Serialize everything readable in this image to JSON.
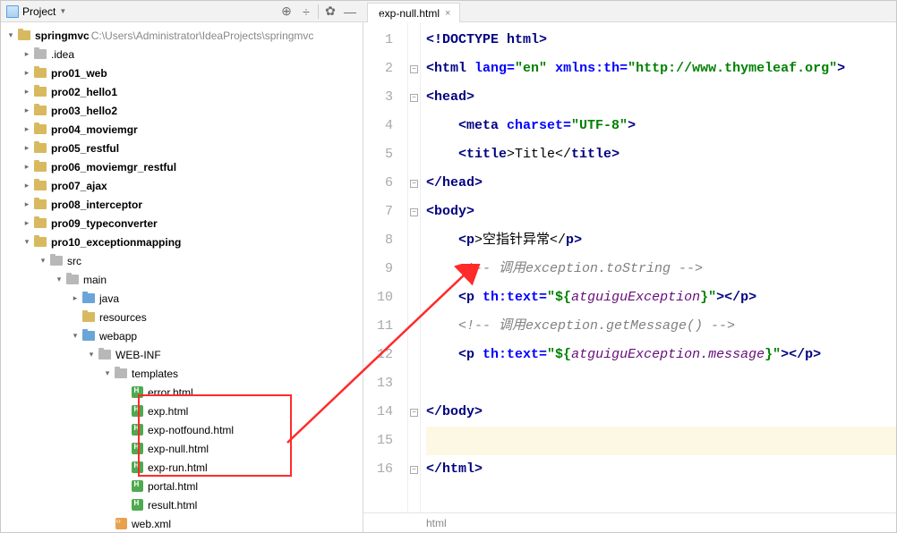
{
  "topbar": {
    "project_label": "Project",
    "target_icon": "target",
    "collapse_icon": "collapse",
    "gear_icon": "gear",
    "hide_icon": "hide"
  },
  "tab": {
    "filename": "exp-null.html"
  },
  "tree": {
    "root": {
      "name": "springmvc",
      "path": "C:\\Users\\Administrator\\IdeaProjects\\springmvc"
    },
    "idea": ".idea",
    "modules": [
      "pro01_web",
      "pro02_hello1",
      "pro03_hello2",
      "pro04_moviemgr",
      "pro05_restful",
      "pro06_moviemgr_restful",
      "pro07_ajax",
      "pro08_interceptor",
      "pro09_typeconverter",
      "pro10_exceptionmapping"
    ],
    "src": "src",
    "main": "main",
    "java": "java",
    "resources": "resources",
    "webapp": "webapp",
    "webinf": "WEB-INF",
    "templates": "templates",
    "files": [
      "error.html",
      "exp.html",
      "exp-notfound.html",
      "exp-null.html",
      "exp-run.html",
      "portal.html",
      "result.html"
    ],
    "webxml": "web.xml"
  },
  "code": {
    "l1": "<!DOCTYPE html>",
    "l2a": "<",
    "l2b": "html ",
    "l2c": "lang=",
    "l2d": "\"en\" ",
    "l2e": "xmlns:th=",
    "l2f": "\"http://www.thymeleaf.org\"",
    "l2g": ">",
    "l3a": "<",
    "l3b": "head",
    "l3c": ">",
    "l4a": "    <",
    "l4b": "meta ",
    "l4c": "charset=",
    "l4d": "\"UTF-8\"",
    "l4e": ">",
    "l5a": "    <",
    "l5b": "title",
    "l5c": ">Title</",
    "l5d": "title",
    "l5e": ">",
    "l6a": "</",
    "l6b": "head",
    "l6c": ">",
    "l7a": "<",
    "l7b": "body",
    "l7c": ">",
    "l8a": "    <",
    "l8b": "p",
    "l8c": ">空指针异常</",
    "l8d": "p",
    "l8e": ">",
    "l9": "    <!-- 调用exception.toString -->",
    "l10a": "    <",
    "l10b": "p ",
    "l10c": "th:text=",
    "l10d": "\"${",
    "l10e": "atguiguException",
    "l10f": "}\"",
    "l10g": "></",
    "l10h": "p",
    "l10i": ">",
    "l11": "    <!-- 调用exception.getMessage() -->",
    "l12a": "    <",
    "l12b": "p ",
    "l12c": "th:text=",
    "l12d": "\"${",
    "l12e": "atguiguException.message",
    "l12f": "}\"",
    "l12g": "></",
    "l12h": "p",
    "l12i": ">",
    "l14a": "</",
    "l14b": "body",
    "l14c": ">",
    "l16a": "</",
    "l16b": "html",
    "l16c": ">"
  },
  "line_numbers": [
    "1",
    "2",
    "3",
    "4",
    "5",
    "6",
    "7",
    "8",
    "9",
    "10",
    "11",
    "12",
    "13",
    "14",
    "15",
    "16"
  ],
  "breadcrumb": {
    "item": "html"
  }
}
